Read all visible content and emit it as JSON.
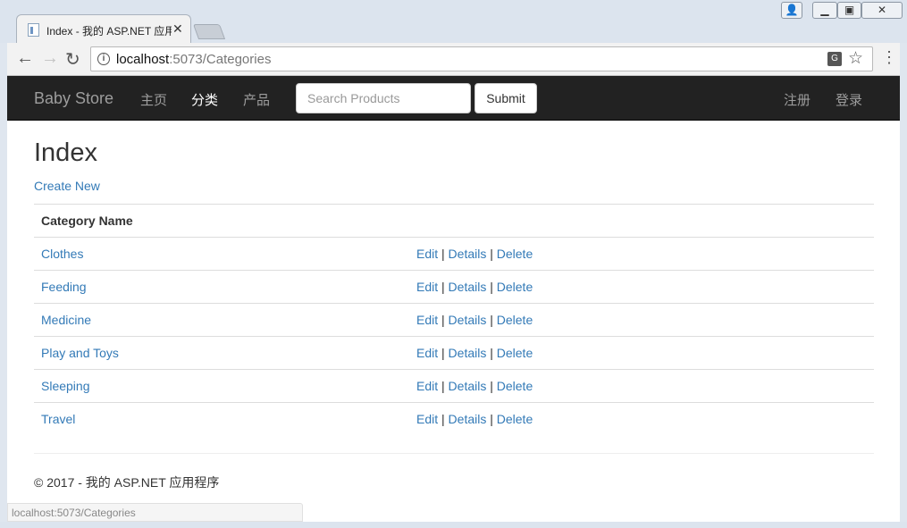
{
  "browser": {
    "tab_title": "Index - 我的 ASP.NET 应用程序",
    "url_host": "localhost",
    "url_rest": ":5073/Categories",
    "status_url": "localhost:5073/Categories"
  },
  "navbar": {
    "brand": "Baby Store",
    "links": [
      "主页",
      "分类",
      "产品"
    ],
    "active_link": "分类",
    "search_placeholder": "Search Products",
    "submit_label": "Submit",
    "register": "注册",
    "login": "登录"
  },
  "page": {
    "title": "Index",
    "create_new": "Create New",
    "column_header": "Category Name",
    "actions": {
      "edit": "Edit",
      "details": "Details",
      "delete": "Delete",
      "separator": "|"
    },
    "categories": [
      "Clothes",
      "Feeding",
      "Medicine",
      "Play and Toys",
      "Sleeping",
      "Travel"
    ]
  },
  "footer": {
    "text": "© 2017 - 我的 ASP.NET 应用程序"
  },
  "colors": {
    "link": "#337ab7",
    "navbar": "#222222",
    "nav_text": "#9d9d9d"
  }
}
